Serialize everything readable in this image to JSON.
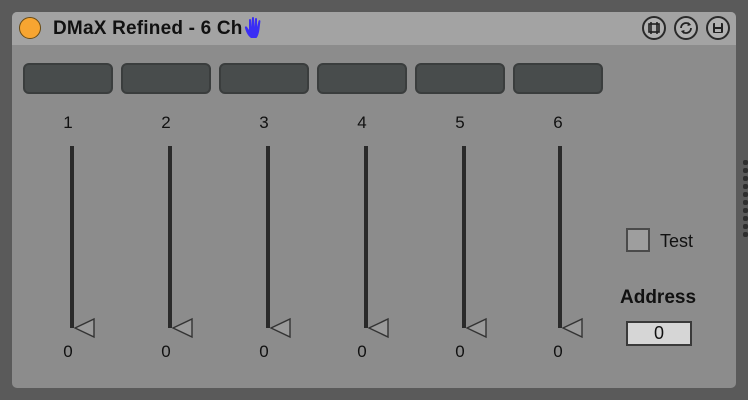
{
  "device": {
    "title": "DMaX Refined - 6 Ch",
    "power_color": "#f7a531",
    "hand_icon": "hand-icon",
    "hand_color": "#3a2df5"
  },
  "header_buttons": [
    {
      "name": "map-icon"
    },
    {
      "name": "refresh-icon"
    },
    {
      "name": "save-icon"
    }
  ],
  "channel_labels": [
    "",
    "",
    "",
    "",
    "",
    ""
  ],
  "channels": [
    {
      "number": "1",
      "value": "0"
    },
    {
      "number": "2",
      "value": "0"
    },
    {
      "number": "3",
      "value": "0"
    },
    {
      "number": "4",
      "value": "0"
    },
    {
      "number": "5",
      "value": "0"
    },
    {
      "number": "6",
      "value": "0"
    }
  ],
  "test": {
    "label": "Test",
    "checked": false
  },
  "address": {
    "label": "Address",
    "value": "0"
  }
}
